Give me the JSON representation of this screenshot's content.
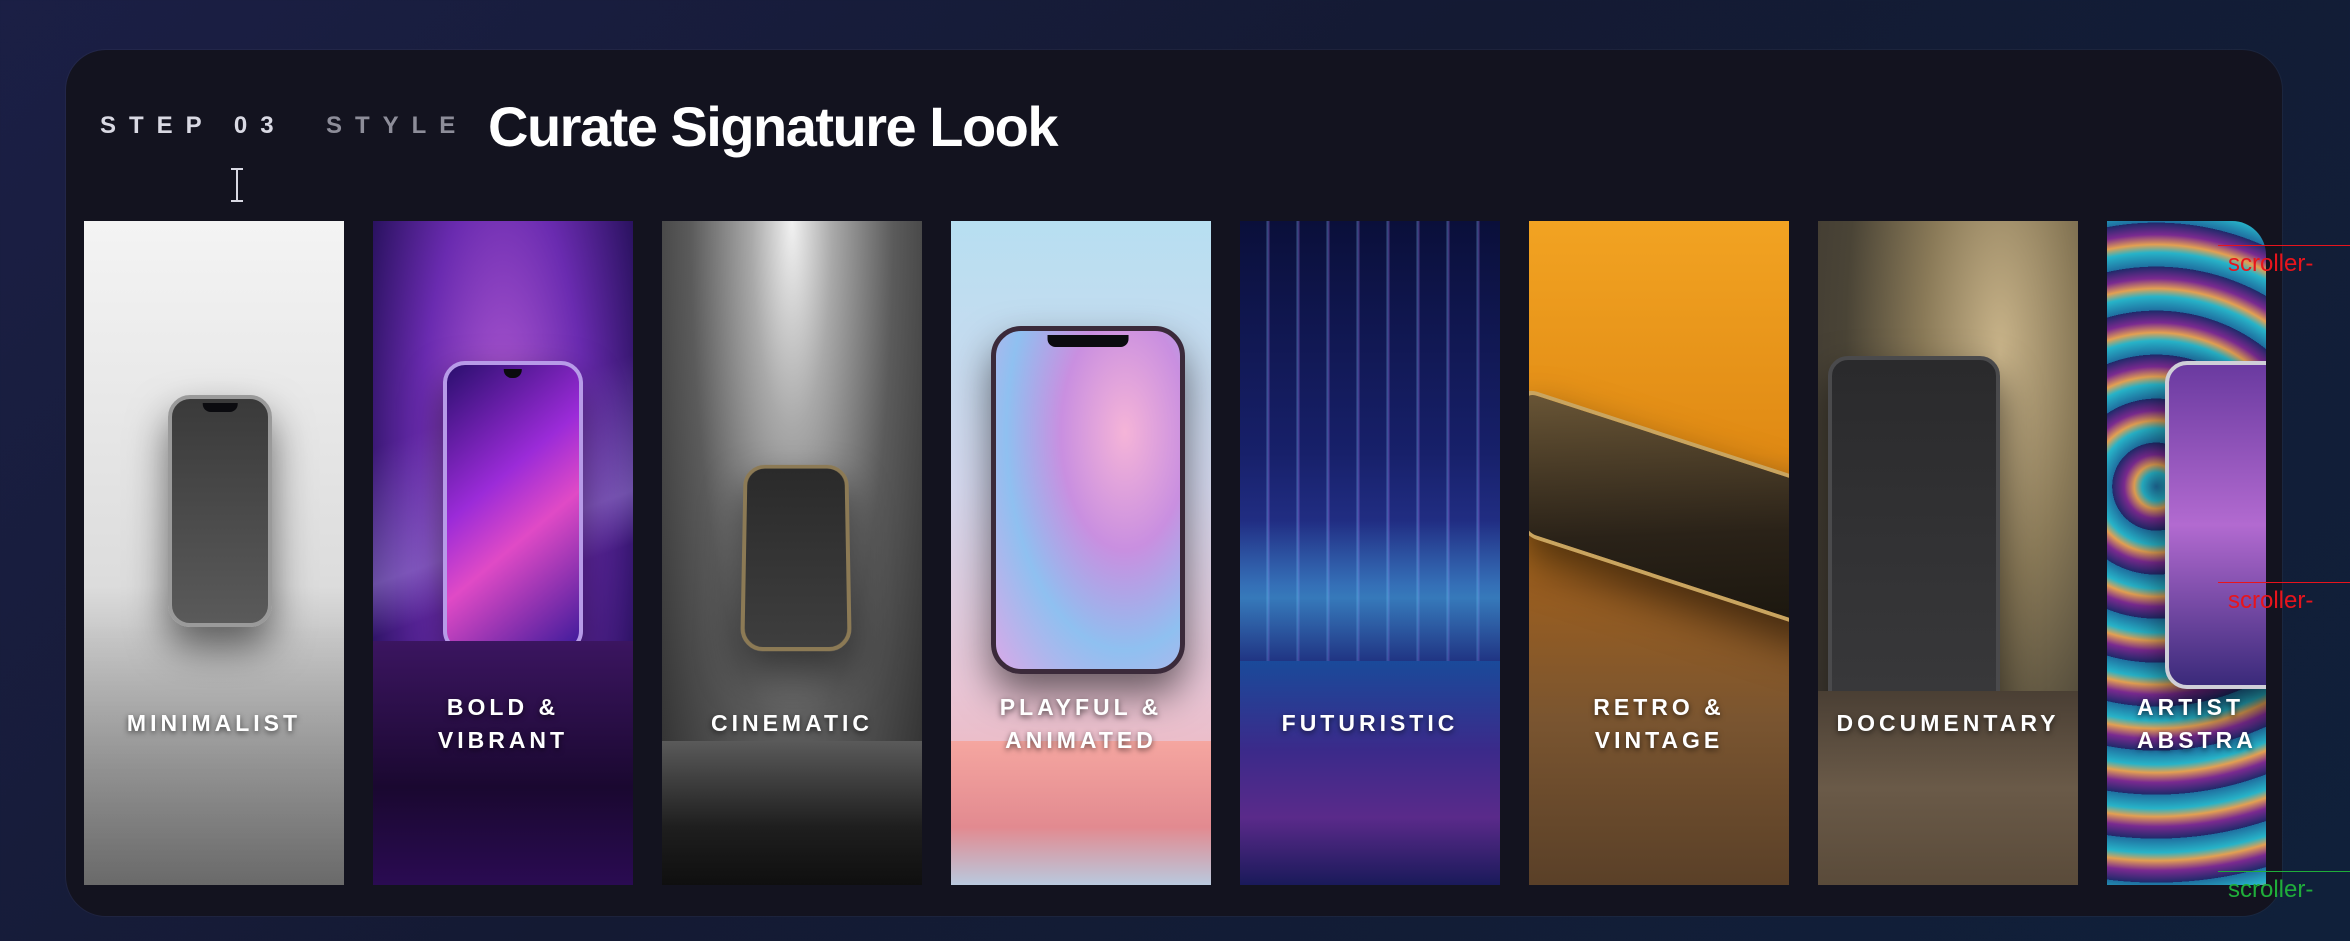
{
  "header": {
    "step_prefix": "STEP 03",
    "step_suffix": "STYLE",
    "title": "Curate Signature Look"
  },
  "cards": [
    {
      "label_line1": "MINIMALIST",
      "label_line2": ""
    },
    {
      "label_line1": "BOLD &",
      "label_line2": "VIBRANT"
    },
    {
      "label_line1": "CINEMATIC",
      "label_line2": ""
    },
    {
      "label_line1": "PLAYFUL &",
      "label_line2": "ANIMATED"
    },
    {
      "label_line1": "FUTURISTIC",
      "label_line2": ""
    },
    {
      "label_line1": "RETRO &",
      "label_line2": "VINTAGE"
    },
    {
      "label_line1": "DOCUMENTARY",
      "label_line2": ""
    },
    {
      "label_line1": "ARTIST",
      "label_line2": "ABSTRA"
    }
  ],
  "debug_markers": {
    "start": "scroller-",
    "end": "scroller-",
    "bottom": "scroller-"
  },
  "colors": {
    "panel": "#13131f",
    "marker_red": "#e8141c",
    "marker_green": "#1fae3a"
  }
}
